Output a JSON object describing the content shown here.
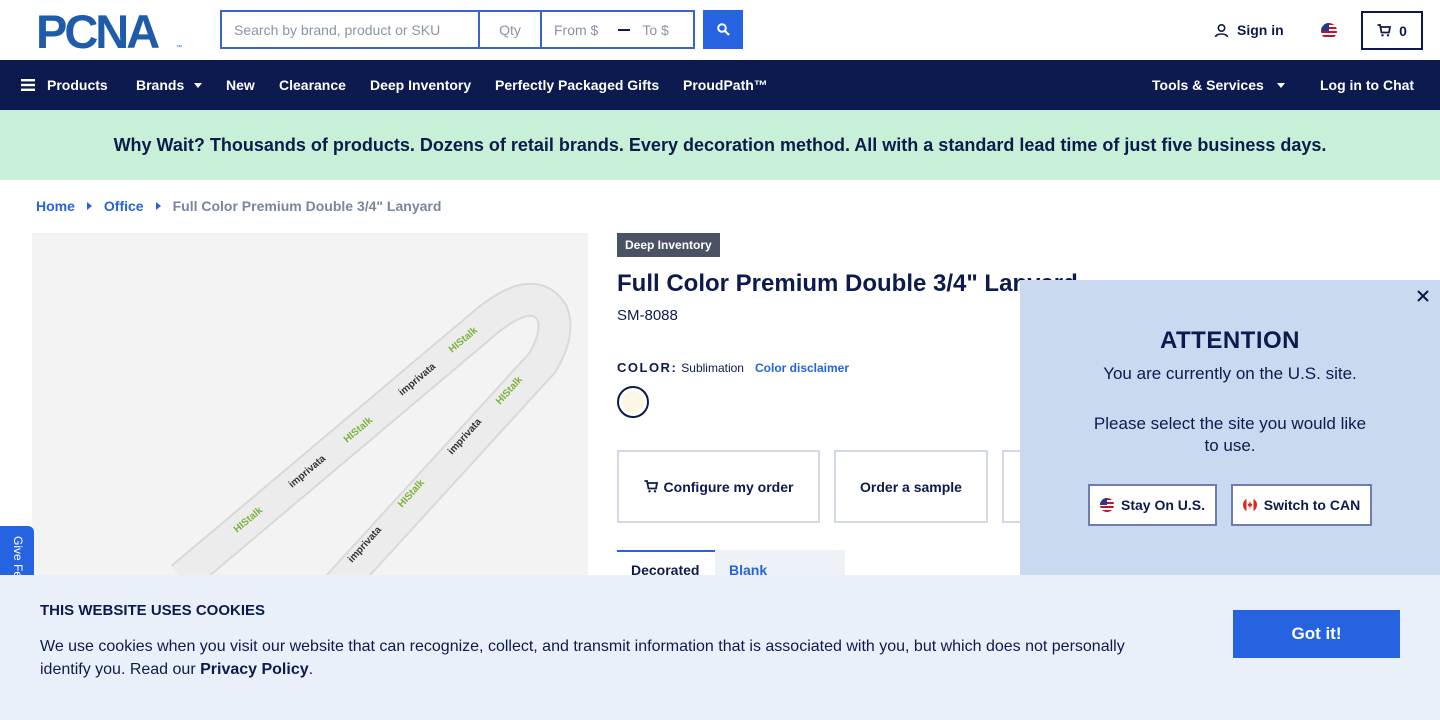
{
  "header": {
    "logo_text": "PCNA",
    "search_placeholder": "Search by brand, product or SKU",
    "qty_placeholder": "Qty",
    "price_from_placeholder": "From $",
    "price_to_placeholder": "To $",
    "signin_label": "Sign in",
    "cart_count": "0",
    "icons": {
      "search": "search-icon",
      "user": "user-icon",
      "cart": "cart-icon",
      "flag": "us-flag-icon"
    }
  },
  "nav": {
    "products_label": "Products",
    "brands_label": "Brands",
    "items": [
      "New",
      "Clearance",
      "Deep Inventory",
      "Perfectly Packaged Gifts",
      "ProudPath™"
    ],
    "tools_label": "Tools & Services",
    "chat_label": "Log in to Chat",
    "bg_color": "#0c1a4f"
  },
  "banner": {
    "text": "Why Wait? Thousands of products. Dozens of retail brands. Every decoration method. All with a standard lead time of just five business days.",
    "bg_color": "#c8efd8"
  },
  "breadcrumb": {
    "home": "Home",
    "office": "Office",
    "current": "Full Color Premium Double 3/4\" Lanyard"
  },
  "product": {
    "badge": "Deep Inventory",
    "title": "Full Color Premium Double 3/4\" Lanyard",
    "sku": "SM-8088",
    "color_label": "COLOR:",
    "color_value": "Sublimation",
    "color_disclaimer": "Color disclaimer",
    "configure_label": "Configure my order",
    "sample_label": "Order a sample",
    "tabs": [
      "Decorated",
      "Blank"
    ],
    "lanyard_print": [
      "HIStalk",
      "imprivata"
    ]
  },
  "feedback": {
    "label": "Give Feedback"
  },
  "modal": {
    "title": "ATTENTION",
    "message1": "You are currently on the U.S. site.",
    "message2": "Please select the site you would like to use.",
    "stay_label": "Stay On U.S.",
    "switch_label": "Switch to CAN",
    "bg_color": "#c9d9ef"
  },
  "cookie": {
    "title": "THIS WEBSITE USES COOKIES",
    "text_before": "We use cookies when you visit our website that can recognize, collect, and transmit information that is associated with you, but which does not personally identify you. Read our ",
    "link_text": "Privacy Policy",
    "text_after": ".",
    "button_label": "Got it!"
  },
  "colors": {
    "primary": "#2563e0",
    "navy": "#0d1b4c"
  }
}
